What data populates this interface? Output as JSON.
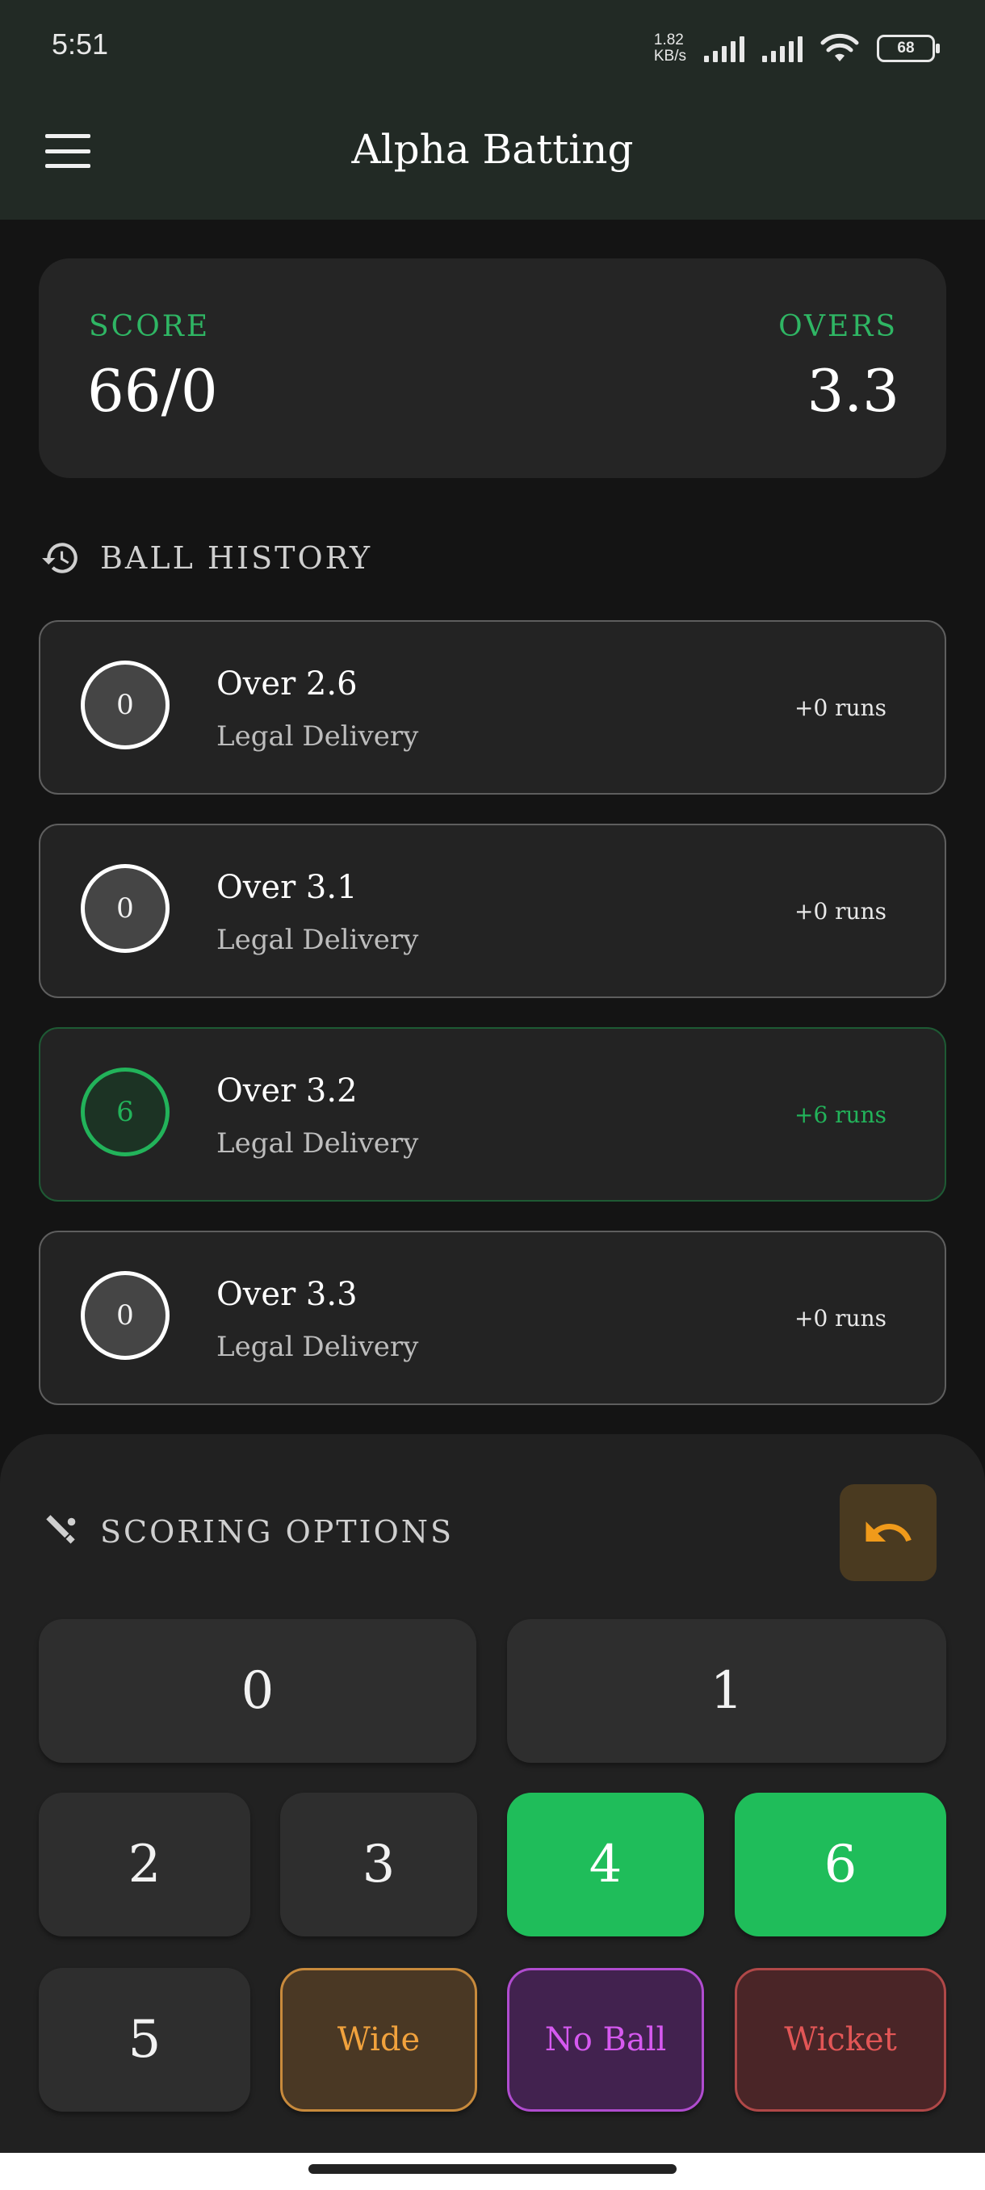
{
  "status_bar": {
    "time": "5:51",
    "net_speed_value": "1.82",
    "net_speed_unit": "KB/s",
    "battery": "68"
  },
  "app_bar": {
    "title": "Alpha Batting"
  },
  "score_card": {
    "score_label": "SCORE",
    "score_value": "66/0",
    "overs_label": "OVERS",
    "overs_value": "3.3"
  },
  "ball_history": {
    "title": "BALL HISTORY",
    "items": [
      {
        "runs": "0",
        "over": "Over 2.6",
        "type": "Legal Delivery",
        "runs_text": "+0 runs",
        "highlight": false
      },
      {
        "runs": "0",
        "over": "Over 3.1",
        "type": "Legal Delivery",
        "runs_text": "+0 runs",
        "highlight": false
      },
      {
        "runs": "6",
        "over": "Over 3.2",
        "type": "Legal Delivery",
        "runs_text": "+6 runs",
        "highlight": true
      },
      {
        "runs": "0",
        "over": "Over 3.3",
        "type": "Legal Delivery",
        "runs_text": "+0 runs",
        "highlight": false
      }
    ]
  },
  "scoring": {
    "title": "SCORING OPTIONS",
    "keys": {
      "zero": "0",
      "one": "1",
      "two": "2",
      "three": "3",
      "four": "4",
      "six": "6",
      "five": "5",
      "wide": "Wide",
      "no_ball": "No Ball",
      "wicket": "Wicket"
    }
  },
  "colors": {
    "accent_green": "#22b35a",
    "undo_orange": "#f09a1a",
    "wide_orange": "#f1a23d",
    "no_ball_purple": "#d659f0",
    "wicket_red": "#e25656"
  }
}
